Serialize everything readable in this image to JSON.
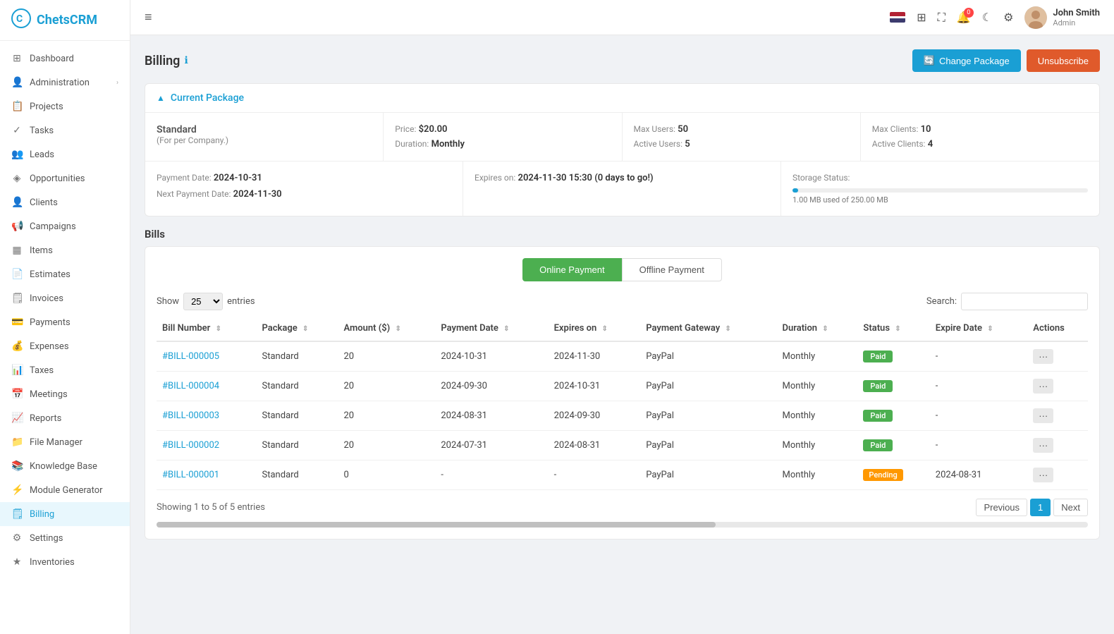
{
  "app": {
    "name": "ChetsCRM",
    "logo_icon": "⚙"
  },
  "sidebar": {
    "items": [
      {
        "id": "dashboard",
        "label": "Dashboard",
        "icon": "⊞",
        "active": false
      },
      {
        "id": "administration",
        "label": "Administration",
        "icon": "👤",
        "hasChevron": true,
        "active": false
      },
      {
        "id": "projects",
        "label": "Projects",
        "icon": "📋",
        "active": false
      },
      {
        "id": "tasks",
        "label": "Tasks",
        "icon": "✓",
        "active": false
      },
      {
        "id": "leads",
        "label": "Leads",
        "icon": "👥",
        "active": false
      },
      {
        "id": "opportunities",
        "label": "Opportunities",
        "icon": "◈",
        "active": false
      },
      {
        "id": "clients",
        "label": "Clients",
        "icon": "👤",
        "active": false
      },
      {
        "id": "campaigns",
        "label": "Campaigns",
        "icon": "📢",
        "active": false
      },
      {
        "id": "items",
        "label": "Items",
        "icon": "▦",
        "active": false
      },
      {
        "id": "estimates",
        "label": "Estimates",
        "icon": "📄",
        "active": false
      },
      {
        "id": "invoices",
        "label": "Invoices",
        "icon": "🗒",
        "active": false
      },
      {
        "id": "payments",
        "label": "Payments",
        "icon": "💳",
        "active": false
      },
      {
        "id": "expenses",
        "label": "Expenses",
        "icon": "💰",
        "active": false
      },
      {
        "id": "taxes",
        "label": "Taxes",
        "icon": "📊",
        "active": false
      },
      {
        "id": "meetings",
        "label": "Meetings",
        "icon": "📅",
        "active": false
      },
      {
        "id": "reports",
        "label": "Reports",
        "icon": "📈",
        "active": false
      },
      {
        "id": "file-manager",
        "label": "File Manager",
        "icon": "📁",
        "active": false
      },
      {
        "id": "knowledge-base",
        "label": "Knowledge Base",
        "icon": "📚",
        "active": false
      },
      {
        "id": "module-generator",
        "label": "Module Generator",
        "icon": "⚡",
        "active": false
      },
      {
        "id": "billing",
        "label": "Billing",
        "icon": "🗒",
        "active": true
      },
      {
        "id": "settings",
        "label": "Settings",
        "icon": "⚙",
        "active": false
      },
      {
        "id": "inventories",
        "label": "Inventories",
        "icon": "★",
        "active": false
      }
    ]
  },
  "topbar": {
    "hamburger": "≡",
    "notification_count": "0",
    "user": {
      "name": "John Smith",
      "role": "Admin"
    }
  },
  "page": {
    "title": "Billing",
    "buttons": {
      "change_package": "Change Package",
      "unsubscribe": "Unsubscribe"
    }
  },
  "current_package": {
    "section_title": "Current Package",
    "package_name": "Standard",
    "package_sub": "(For per Company.)",
    "price_label": "Price:",
    "price_value": "$20.00",
    "duration_label": "Duration:",
    "duration_value": "Monthly",
    "max_users_label": "Max Users:",
    "max_users_value": "50",
    "active_users_label": "Active Users:",
    "active_users_value": "5",
    "max_clients_label": "Max Clients:",
    "max_clients_value": "10",
    "active_clients_label": "Active Clients:",
    "active_clients_value": "4",
    "payment_date_label": "Payment Date:",
    "payment_date_value": "2024-10-31",
    "next_payment_label": "Next Payment Date:",
    "next_payment_value": "2024-11-30",
    "expires_label": "Expires on:",
    "expires_value": "2024-11-30 15:30 (0 days to go!)",
    "storage_label": "Storage Status:",
    "storage_used": "1.00 MB used of 250.00 MB",
    "storage_percent": 0.4
  },
  "bills": {
    "title": "Bills",
    "btn_online": "Online Payment",
    "btn_offline": "Offline Payment",
    "show_label": "Show",
    "show_value": "25",
    "entries_label": "entries",
    "search_label": "Search:",
    "search_placeholder": "",
    "columns": [
      {
        "key": "bill_number",
        "label": "Bill Number"
      },
      {
        "key": "package",
        "label": "Package"
      },
      {
        "key": "amount",
        "label": "Amount ($)"
      },
      {
        "key": "payment_date",
        "label": "Payment Date"
      },
      {
        "key": "expires_on",
        "label": "Expires on"
      },
      {
        "key": "payment_gateway",
        "label": "Payment Gateway"
      },
      {
        "key": "duration",
        "label": "Duration"
      },
      {
        "key": "status",
        "label": "Status"
      },
      {
        "key": "expire_date",
        "label": "Expire Date"
      },
      {
        "key": "actions",
        "label": "Actions"
      }
    ],
    "rows": [
      {
        "bill_number": "#BILL-000005",
        "package": "Standard",
        "amount": "20",
        "payment_date": "2024-10-31",
        "expires_on": "2024-11-30",
        "payment_gateway": "PayPal",
        "duration": "Monthly",
        "status": "Paid",
        "status_type": "paid",
        "expire_date": "-"
      },
      {
        "bill_number": "#BILL-000004",
        "package": "Standard",
        "amount": "20",
        "payment_date": "2024-09-30",
        "expires_on": "2024-10-31",
        "payment_gateway": "PayPal",
        "duration": "Monthly",
        "status": "Paid",
        "status_type": "paid",
        "expire_date": "-"
      },
      {
        "bill_number": "#BILL-000003",
        "package": "Standard",
        "amount": "20",
        "payment_date": "2024-08-31",
        "expires_on": "2024-09-30",
        "payment_gateway": "PayPal",
        "duration": "Monthly",
        "status": "Paid",
        "status_type": "paid",
        "expire_date": "-"
      },
      {
        "bill_number": "#BILL-000002",
        "package": "Standard",
        "amount": "20",
        "payment_date": "2024-07-31",
        "expires_on": "2024-08-31",
        "payment_gateway": "PayPal",
        "duration": "Monthly",
        "status": "Paid",
        "status_type": "paid",
        "expire_date": "-"
      },
      {
        "bill_number": "#BILL-000001",
        "package": "Standard",
        "amount": "0",
        "payment_date": "-",
        "expires_on": "-",
        "payment_gateway": "PayPal",
        "duration": "Monthly",
        "status": "Pending",
        "status_type": "pending",
        "expire_date": "2024-08-31"
      }
    ],
    "showing_text": "Showing 1 to 5 of 5 entries",
    "pagination": {
      "prev": "Previous",
      "pages": [
        "1"
      ],
      "next": "Next",
      "active": "1"
    }
  }
}
